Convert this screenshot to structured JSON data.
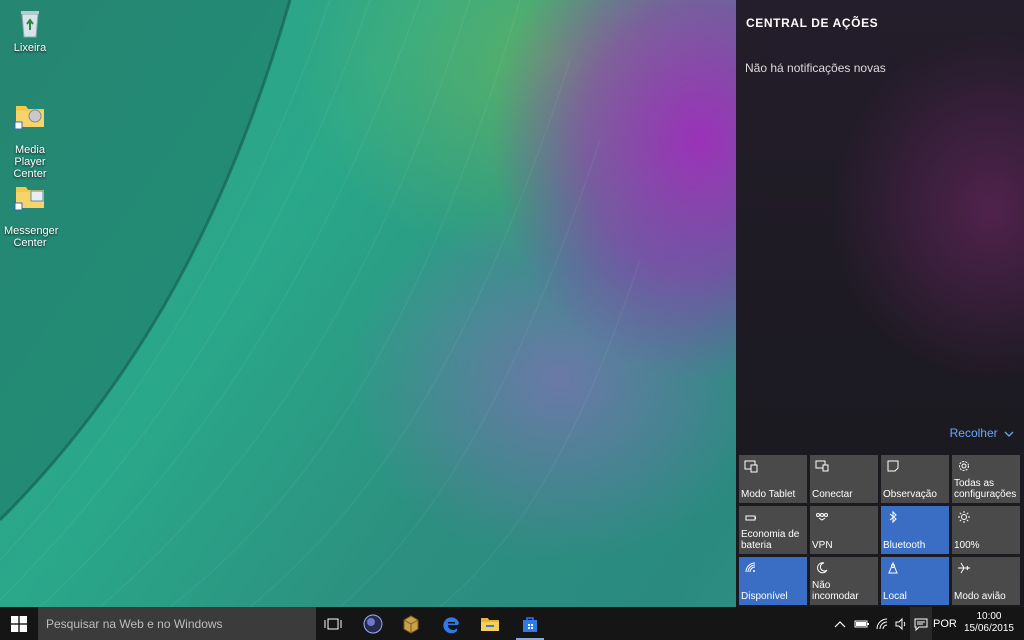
{
  "desktop": {
    "icons": [
      {
        "label": "Lixeira",
        "icon": "recycle-bin-icon"
      },
      {
        "label": "Media Player\nCenter",
        "icon": "media-player-folder-icon"
      },
      {
        "label": "Messenger\nCenter",
        "icon": "messenger-folder-icon"
      }
    ]
  },
  "action_center": {
    "title": "CENTRAL DE AÇÕES",
    "empty_text": "Não há notificações novas",
    "collapse_label": "Recolher",
    "tiles": [
      {
        "label": "Modo Tablet",
        "icon": "tablet-mode-icon",
        "active": false
      },
      {
        "label": "Conectar",
        "icon": "connect-icon",
        "active": false
      },
      {
        "label": "Observação",
        "icon": "note-icon",
        "active": false
      },
      {
        "label": "Todas as configurações",
        "icon": "settings-gear-icon",
        "active": false
      },
      {
        "label": "Economia de bateria",
        "icon": "battery-saver-icon",
        "active": false
      },
      {
        "label": "VPN",
        "icon": "vpn-icon",
        "active": false
      },
      {
        "label": "Bluetooth",
        "icon": "bluetooth-icon",
        "active": true
      },
      {
        "label": "100%",
        "icon": "brightness-icon",
        "active": false
      },
      {
        "label": "Disponível",
        "icon": "wifi-icon",
        "active": true
      },
      {
        "label": "Não incomodar",
        "icon": "moon-icon",
        "active": false
      },
      {
        "label": "Local",
        "icon": "location-icon",
        "active": true
      },
      {
        "label": "Modo avião",
        "icon": "airplane-icon",
        "active": false
      }
    ]
  },
  "taskbar": {
    "search_placeholder": "Pesquisar na Web e no Windows",
    "language": "POR",
    "time": "10:00",
    "date": "15/06/2015"
  },
  "colors": {
    "accent": "#3a6ec4",
    "tile_off": "#4a4a4a",
    "link": "#6aa6ff",
    "taskbar": "#151515"
  }
}
